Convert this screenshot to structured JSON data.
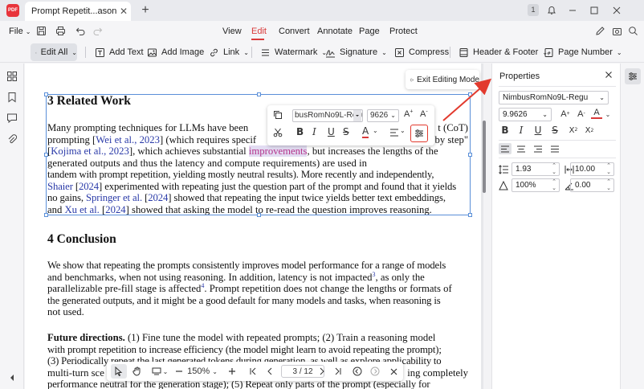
{
  "titlebar": {
    "logo_text": "PDF",
    "tab_title": "Prompt Repetit...asoning LLMs",
    "page_badge": "1"
  },
  "menubar": {
    "file": "File",
    "items": [
      "View",
      "Edit",
      "Convert",
      "Annotate",
      "Page",
      "Protect"
    ]
  },
  "toolbar": {
    "edit_all": "Edit All",
    "add_text": "Add Text",
    "add_image": "Add Image",
    "link": "Link",
    "watermark": "Watermark",
    "signature": "Signature",
    "compress": "Compress",
    "header_footer": "Header & Footer",
    "page_number": "Page Number"
  },
  "document": {
    "section3_title": "3   Related Work",
    "section4_title": "4   Conclusion",
    "p1": [
      [
        "Many prompting techniques for LLMs have been",
        "t (CoT)"
      ],
      [
        "prompting ",
        "Wei et al., 2023",
        "] (which requires specif",
        "by step\""
      ],
      [
        "[",
        "Kojima et al., 2023",
        "], which achieves substantial ",
        "improvements",
        ", but increases the lengths of the"
      ],
      [
        "generated outputs and thus the latency and compute requirements) are used in"
      ],
      [
        "tandem with prompt repetition, yielding mostly neutral results). More recently and independently,"
      ],
      [
        "Shaier",
        " [",
        "2024",
        "] experimented with repeating just the question part of the prompt and found that it yields"
      ],
      [
        "no gains, ",
        "Springer et al.",
        " [",
        "2024",
        "] showed that repeating the input twice yields better text embeddings,"
      ],
      [
        "and ",
        "Xu et al.",
        " [",
        "2024",
        "] showed that asking the model to re-read the question improves reasoning."
      ]
    ],
    "p2": [
      "We show that repeating the prompts consistently improves model performance for a range of models",
      "and benchmarks, when not using reasoning.  In addition, latency is not impacted",
      ", as only the",
      "parallelizable pre-fill stage is affected",
      ". Prompt repetition does not change the lengths or formats of",
      "the generated outputs, and it might be a good default for many models and tasks, when reasoning is",
      "not used."
    ],
    "p2_sup1": "3",
    "p2_sup2": "4",
    "p3": [
      "Future directions.",
      "     (1) Fine tune the model with repeated prompts; (2) Train a reasoning model",
      "with prompt repetition to increase efficiency (the model might learn to avoid repeating the prompt);",
      "(3) Periodically repeat the last generated tokens during generation, as well as explore applicability to",
      "multi-turn sce",
      "ing completely",
      "performance neutral for the generation stage); (5) Repeat only parts of the prompt (especially for"
    ]
  },
  "float_toolbar": {
    "font": "busRomNo9L-Regu",
    "size": "9626"
  },
  "exit_editing": "Exit Editing Mode",
  "bottom_nav": {
    "zoom": "150%",
    "page": "3 / 12"
  },
  "properties": {
    "title": "Properties",
    "font": "NimbusRomNo9L-Regu",
    "size": "9.9626",
    "line_spacing": "1.93",
    "char_spacing": "10.00",
    "opacity": "100%",
    "rotation": "0.00"
  },
  "colors": {
    "accent_red": "#d93a3a",
    "link_blue": "#2a3aa8",
    "highlight": "#b4338a"
  }
}
